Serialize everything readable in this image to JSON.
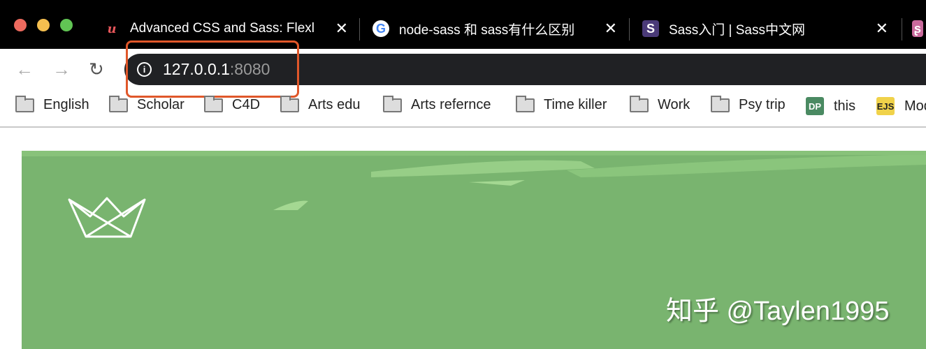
{
  "window": {
    "lights": [
      "#ed6a5e",
      "#f5bf4f",
      "#61c554"
    ]
  },
  "tabs": [
    {
      "title": "Advanced CSS and Sass: Flexl",
      "icon": "udemy-icon",
      "icon_glyph": "u",
      "icon_color": "#e5565a"
    },
    {
      "title": "node-sass 和 sass有什么区别",
      "icon": "google-icon",
      "icon_glyph": "G",
      "icon_color": "#4285f4"
    },
    {
      "title": "Sass入门 | Sass中文网",
      "icon": "sass-s-icon",
      "icon_glyph": "S",
      "icon_color": "#4a3a78"
    },
    {
      "title": "",
      "icon": "sass-logo-icon",
      "icon_glyph": "ʂ",
      "icon_color": "#c96a9c"
    }
  ],
  "close_glyph": "✕",
  "address": {
    "host": "127.0.0.1",
    "port": ":8080",
    "highlight_color": "#e0572a"
  },
  "bookmarks": [
    {
      "label": "English",
      "icon": "folder-icon"
    },
    {
      "label": "Scholar",
      "icon": "folder-icon"
    },
    {
      "label": "C4D",
      "icon": "folder-icon"
    },
    {
      "label": "Arts edu",
      "icon": "folder-icon"
    },
    {
      "label": "Arts refernce",
      "icon": "folder-icon"
    },
    {
      "label": "Time killer",
      "icon": "folder-icon"
    },
    {
      "label": "Work",
      "icon": "folder-icon"
    },
    {
      "label": "Psy trip",
      "icon": "folder-icon"
    },
    {
      "label": "this",
      "icon": "dp-icon",
      "badge": "DP"
    },
    {
      "label": "Mod",
      "icon": "ejs-icon",
      "badge": "EJS"
    }
  ],
  "hero": {
    "background": "#79b46f",
    "watermark": "知乎 @Taylen1995"
  }
}
